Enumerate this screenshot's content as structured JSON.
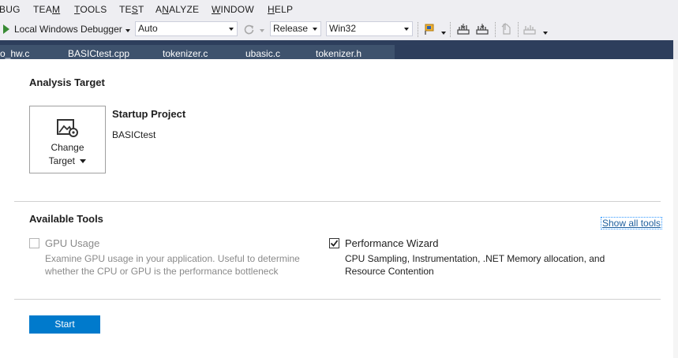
{
  "menu": {
    "items": [
      {
        "pre": "",
        "mn": "",
        "post": "BUG"
      },
      {
        "pre": "TEA",
        "mn": "M",
        "post": ""
      },
      {
        "pre": "",
        "mn": "T",
        "post": "OOLS"
      },
      {
        "pre": "TE",
        "mn": "S",
        "post": "T"
      },
      {
        "pre": "A",
        "mn": "N",
        "post": "ALYZE"
      },
      {
        "pre": "",
        "mn": "W",
        "post": "INDOW"
      },
      {
        "pre": "",
        "mn": "H",
        "post": "ELP"
      }
    ]
  },
  "toolbar": {
    "debugger_label": "Local Windows Debugger",
    "mode_value": "Auto",
    "config_value": "Release",
    "platform_value": "Win32"
  },
  "tabs": [
    "o_hw.c",
    "BASICtest.cpp",
    "tokenizer.c",
    "ubasic.c",
    "tokenizer.h"
  ],
  "analysis_target": {
    "heading": "Analysis Target",
    "change_target_line1": "Change",
    "change_target_line2": "Target",
    "startup_heading": "Startup Project",
    "project_name": "BASICtest"
  },
  "available_tools": {
    "heading": "Available Tools",
    "show_all_label": "Show all tools",
    "gpu": {
      "title": "GPU Usage",
      "checked": false,
      "enabled": false,
      "desc_line1": "Examine GPU usage in your application. Useful to determine",
      "desc_line2": "whether the CPU or GPU is the performance bottleneck"
    },
    "perf": {
      "title": "Performance Wizard",
      "checked": true,
      "enabled": true,
      "desc_line1": "CPU Sampling, Instrumentation, .NET Memory allocation, and",
      "desc_line2": "Resource Contention"
    }
  },
  "start_button_label": "Start",
  "colors": {
    "chrome": "#eeeef2",
    "tab_strip": "#2d3e5c",
    "accent_blue": "#007acc",
    "link": "#1e5f9e",
    "disabled_text": "#8a8a8a"
  }
}
